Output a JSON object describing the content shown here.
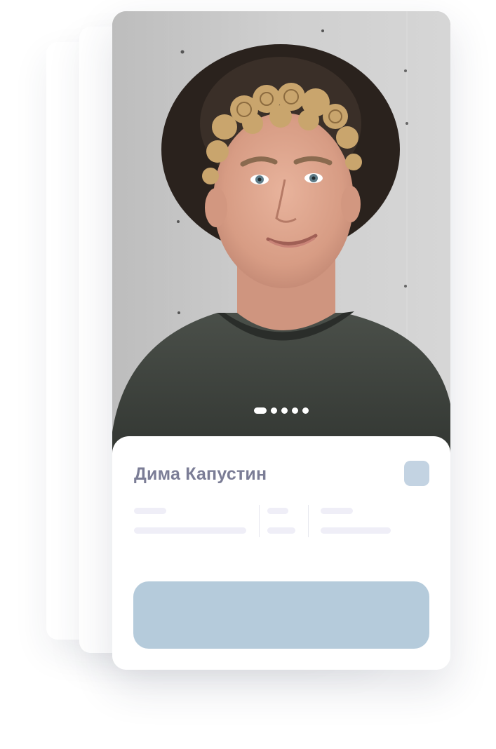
{
  "profile": {
    "name": "Дима Капустин",
    "photo_indicator": {
      "total": 5,
      "active_index": 0
    }
  },
  "colors": {
    "name_text": "#7b7d96",
    "badge": "#c3d3e2",
    "placeholder": "#efeef7",
    "cta_button": "#b5cbdb"
  }
}
